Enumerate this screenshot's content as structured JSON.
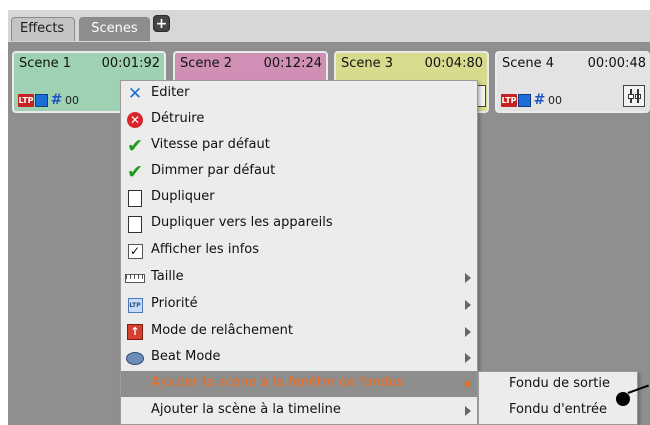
{
  "tabs": [
    {
      "label": "Effects",
      "active": false
    },
    {
      "label": "Scenes",
      "active": true
    }
  ],
  "add_tab_label": "+",
  "scenes": [
    {
      "name": "Scene 1",
      "time": "00:01:92",
      "color": "#9fd2b2",
      "ltp": "LTP",
      "hash": "#",
      "counter": "00"
    },
    {
      "name": "Scene 2",
      "time": "00:12:24",
      "color": "#d08fb5"
    },
    {
      "name": "Scene 3",
      "time": "00:04:80",
      "color": "#d7db8e"
    },
    {
      "name": "Scene 4",
      "time": "00:00:48",
      "color": "#e3e3e3",
      "ltp": "LTP",
      "hash": "#",
      "counter": "00"
    }
  ],
  "menu": {
    "items": [
      {
        "label": "Editer",
        "icon": "tools-icon"
      },
      {
        "label": "Détruire",
        "icon": "destroy-icon"
      },
      {
        "label": "Vitesse par défaut",
        "icon": "check-icon"
      },
      {
        "label": "Dimmer par défaut",
        "icon": "check-icon"
      },
      {
        "label": "Dupliquer",
        "icon": "duplicate-icon"
      },
      {
        "label": "Dupliquer vers les appareils",
        "icon": "duplicate-icon"
      },
      {
        "label": "Afficher les infos",
        "icon": "checkbox-icon",
        "checked": true
      },
      {
        "label": "Taille",
        "icon": "ruler-icon",
        "submenu": true
      },
      {
        "label": "Priorité",
        "icon": "priority-icon",
        "priority_text": "LTP",
        "submenu": true
      },
      {
        "label": "Mode de relâchement",
        "icon": "release-icon",
        "submenu": true
      },
      {
        "label": "Beat Mode",
        "icon": "beat-icon",
        "submenu": true
      },
      {
        "label": "Ajouter la scène à la fenêtre de fondus",
        "icon": "",
        "submenu": true,
        "highlighted": true
      },
      {
        "label": "Ajouter la scène à la timeline",
        "icon": "",
        "submenu": true
      }
    ]
  },
  "submenu": {
    "items": [
      {
        "label": "Fondu de sortie"
      },
      {
        "label": "Fondu d'entrée"
      }
    ]
  },
  "colors": {
    "highlight_bg": "#8e8e8e",
    "highlight_text": "#f06a1a",
    "menu_bg": "#ececec",
    "grid_bg": "#8f8f8f"
  }
}
